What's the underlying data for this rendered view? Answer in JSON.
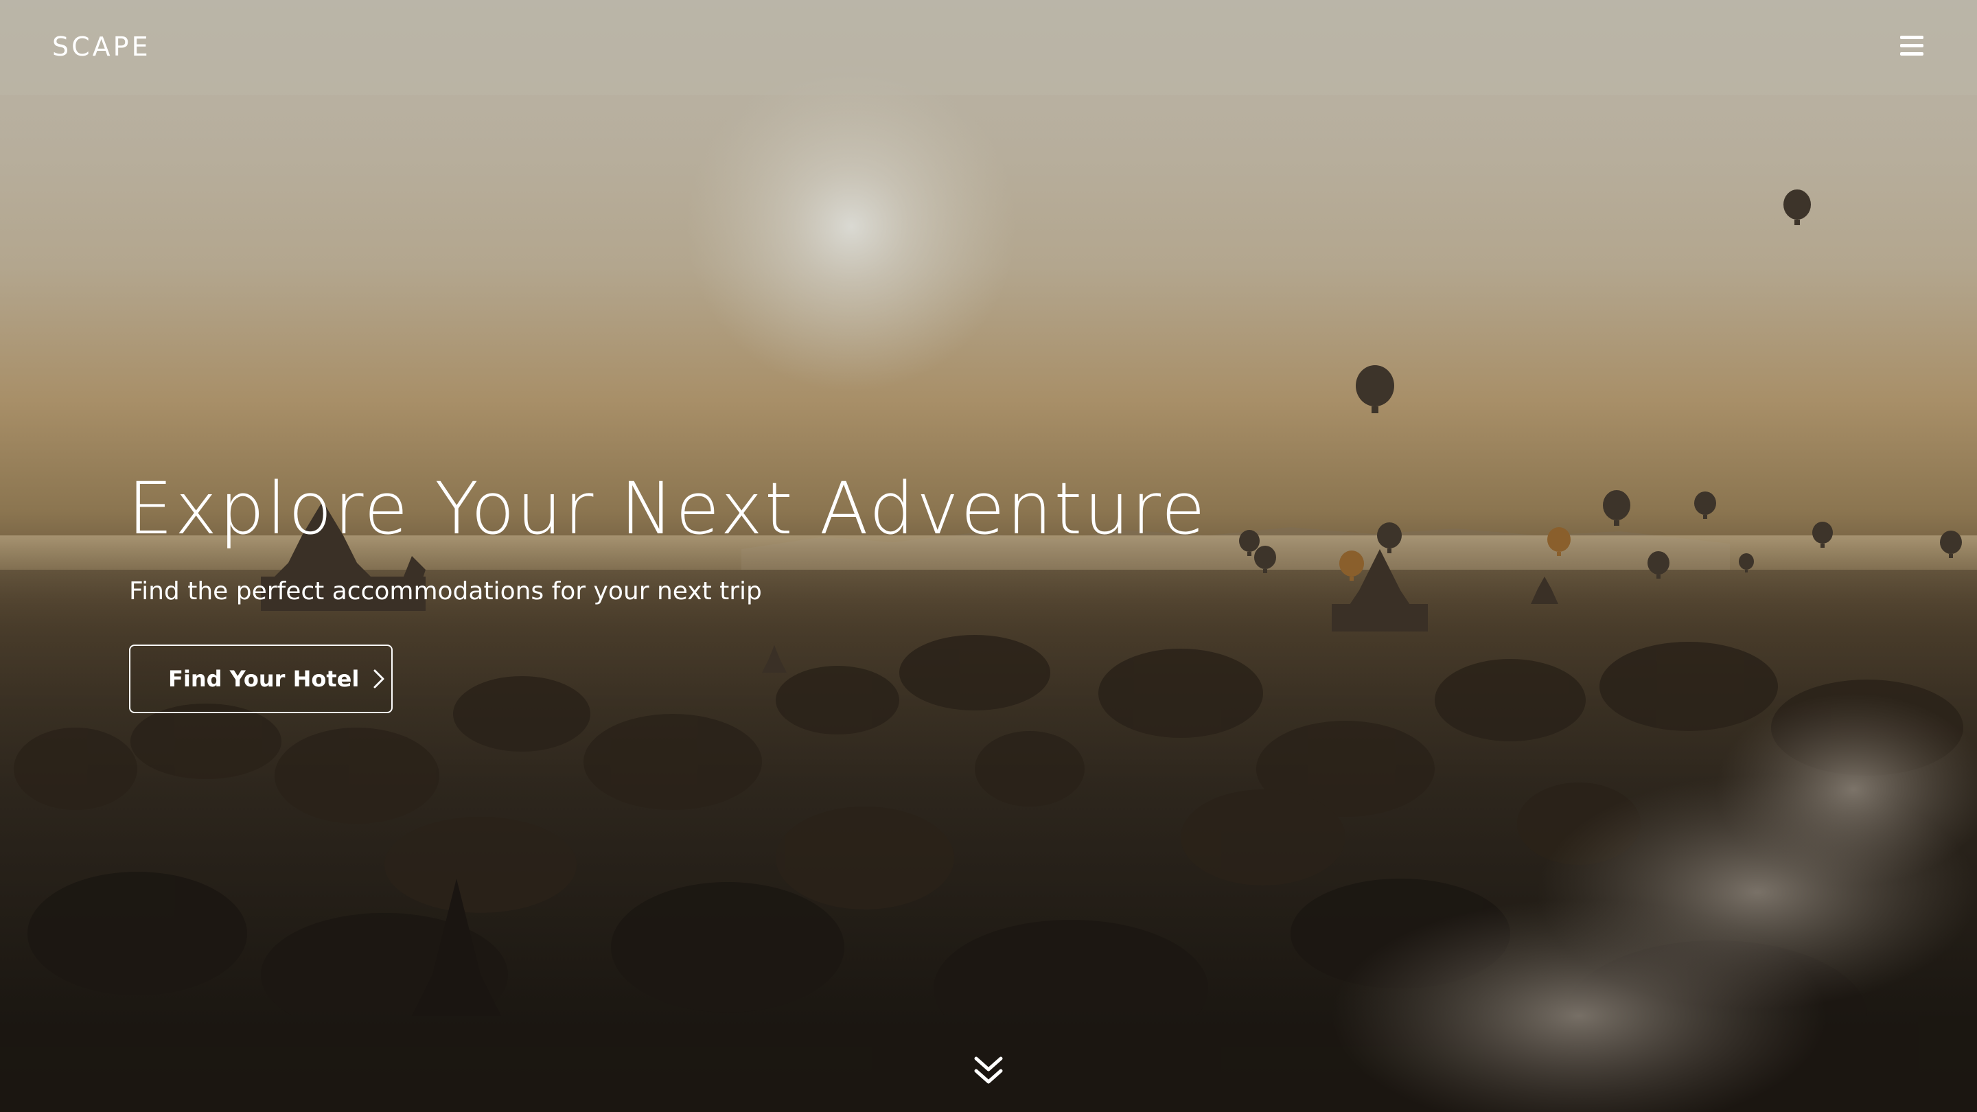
{
  "header": {
    "logo_text": "SCAPE",
    "menu_icon": "hamburger-menu-icon"
  },
  "hero": {
    "background_image": "hot-air-balloons-over-temple-plain-at-sunrise",
    "title": "Explore Your Next Adventure",
    "subtitle": "Find the perfect accommodations for your next trip",
    "cta_label": "Find Your Hotel",
    "cta_icon": "chevron-right-icon",
    "scroll_icon": "double-chevron-down-icon"
  },
  "colors": {
    "text": "#ffffff",
    "header_bg": "#bcb6a8"
  }
}
